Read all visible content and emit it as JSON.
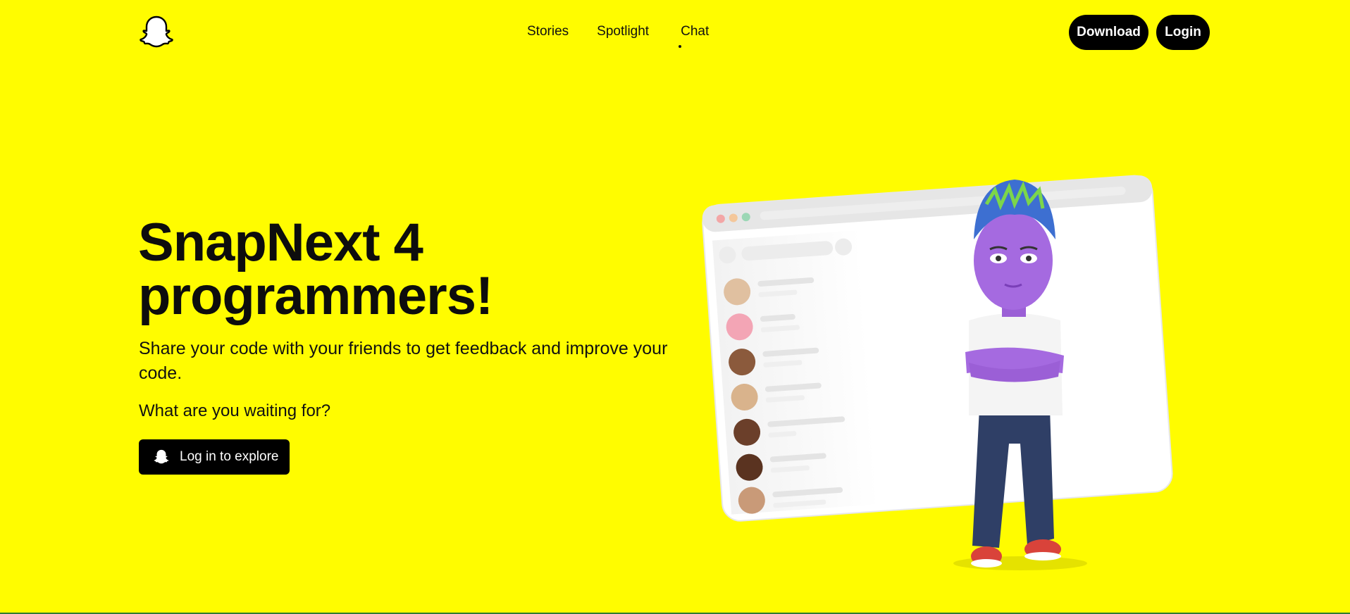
{
  "header": {
    "logo_icon": "snapchat-ghost-icon",
    "nav": [
      {
        "label": "Stories"
      },
      {
        "label": "Spotlight"
      },
      {
        "label": "Chat"
      }
    ],
    "download_label": "Download",
    "login_label": "Login"
  },
  "hero": {
    "title_line1": "SnapNext 4",
    "title_line2": "programmers!",
    "subtitle": "Share your code with your friends to get feedback and improve your code.",
    "question": "What are you waiting for?",
    "cta_label": "Log in to explore",
    "cta_icon": "snapchat-ghost-icon"
  },
  "colors": {
    "background": "#fffc00",
    "button": "#000000",
    "button_text": "#ffffff"
  }
}
